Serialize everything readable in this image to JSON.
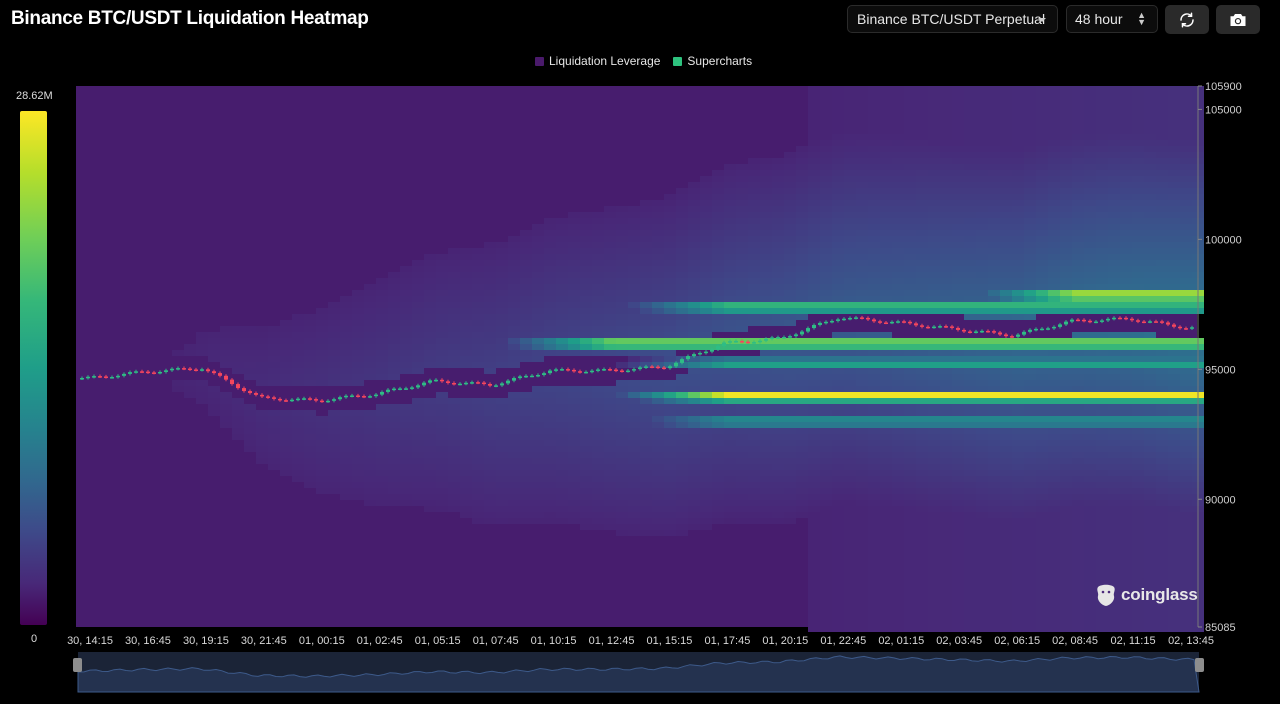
{
  "header": {
    "title": "Binance BTC/USDT Liquidation Heatmap",
    "market_select": "Binance BTC/USDT Perpetual",
    "range_select": "48 hour"
  },
  "legend": [
    {
      "label": "Liquidation Leverage",
      "color": "#4a1a6b"
    },
    {
      "label": "Supercharts",
      "color": "#2ec27e"
    }
  ],
  "colorscale": {
    "max_label": "28.62M",
    "min_label": "0"
  },
  "watermark": "coinglass",
  "icons": {
    "refresh": "refresh-icon",
    "camera": "camera-icon",
    "logo": "coinglass-logo-icon"
  },
  "chart_data": {
    "type": "heatmap",
    "title": "Binance BTC/USDT Liquidation Heatmap",
    "y_tick_labels": [
      "105900",
      "105000",
      "100000",
      "95000",
      "90000",
      "85085"
    ],
    "y_range": [
      85085,
      105900
    ],
    "x_tick_labels": [
      "30, 14:15",
      "30, 16:45",
      "30, 19:15",
      "30, 21:45",
      "01, 00:15",
      "01, 02:45",
      "01, 05:15",
      "01, 07:45",
      "01, 10:15",
      "01, 12:45",
      "01, 15:15",
      "01, 17:45",
      "01, 20:15",
      "01, 22:45",
      "02, 01:15",
      "02, 03:45",
      "02, 06:15",
      "02, 08:45",
      "02, 11:15",
      "02, 13:45"
    ],
    "price_series": {
      "name": "Supercharts",
      "x": [
        "30, 14:15",
        "30, 16:45",
        "30, 19:15",
        "30, 21:45",
        "01, 00:15",
        "01, 02:45",
        "01, 05:15",
        "01, 07:45",
        "01, 10:15",
        "01, 12:45",
        "01, 15:15",
        "01, 17:45",
        "01, 20:15",
        "01, 22:45",
        "02, 01:15",
        "02, 03:45",
        "02, 06:15",
        "02, 08:45",
        "02, 11:15",
        "02, 13:45"
      ],
      "values": [
        94650,
        94900,
        95050,
        93900,
        93800,
        94050,
        94550,
        94400,
        94950,
        94950,
        95100,
        96000,
        96200,
        97000,
        96800,
        96550,
        96300,
        96850,
        96950,
        96600
      ]
    },
    "liquidation_bands": [
      {
        "price": 94000,
        "intensity": 1.0,
        "from": "01, 17:45"
      },
      {
        "price": 97850,
        "intensity": 1.0,
        "from": "02, 08:45"
      },
      {
        "price": 96000,
        "intensity": 0.9,
        "from": "01, 12:45"
      },
      {
        "price": 97400,
        "intensity": 0.75,
        "from": "01, 17:45"
      },
      {
        "price": 95200,
        "intensity": 0.6,
        "from": "01, 17:45"
      },
      {
        "price": 93000,
        "intensity": 0.55,
        "from": "01, 17:45"
      }
    ],
    "colorscale_range": [
      0,
      28620000
    ],
    "colorscale_name": "viridis",
    "legend_position": "top-center"
  }
}
